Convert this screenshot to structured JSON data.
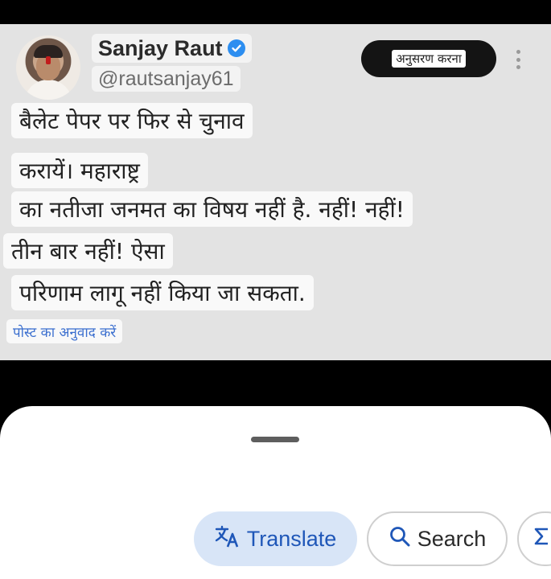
{
  "tweet": {
    "author_name": "Sanjay Raut",
    "handle": "@rautsanjay61",
    "follow_label": "अनुसरण करना",
    "lines": [
      "बैलेट पेपर पर फिर से चुनाव",
      "करायें। महाराष्ट्र",
      "का नतीजा जनमत का विषय नहीं है. नहीं! नहीं!",
      "तीन बार नहीं! ऐसा",
      "परिणाम लागू नहीं किया जा सकता."
    ],
    "translate_post_label": "पोस्ट का अनुवाद करें"
  },
  "sheet": {
    "translate_label": "Translate",
    "search_label": "Search"
  },
  "icons": {
    "verified": "verified-badge-icon",
    "more": "more-vertical-icon",
    "translate": "translate-icon",
    "search": "search-icon",
    "partial": "partial-chip-icon"
  },
  "colors": {
    "verified": "#2d8ef0",
    "translate_chip_bg": "#d8e5f7",
    "translate_chip_text": "#1f57b8",
    "link": "#3b6fcf"
  }
}
